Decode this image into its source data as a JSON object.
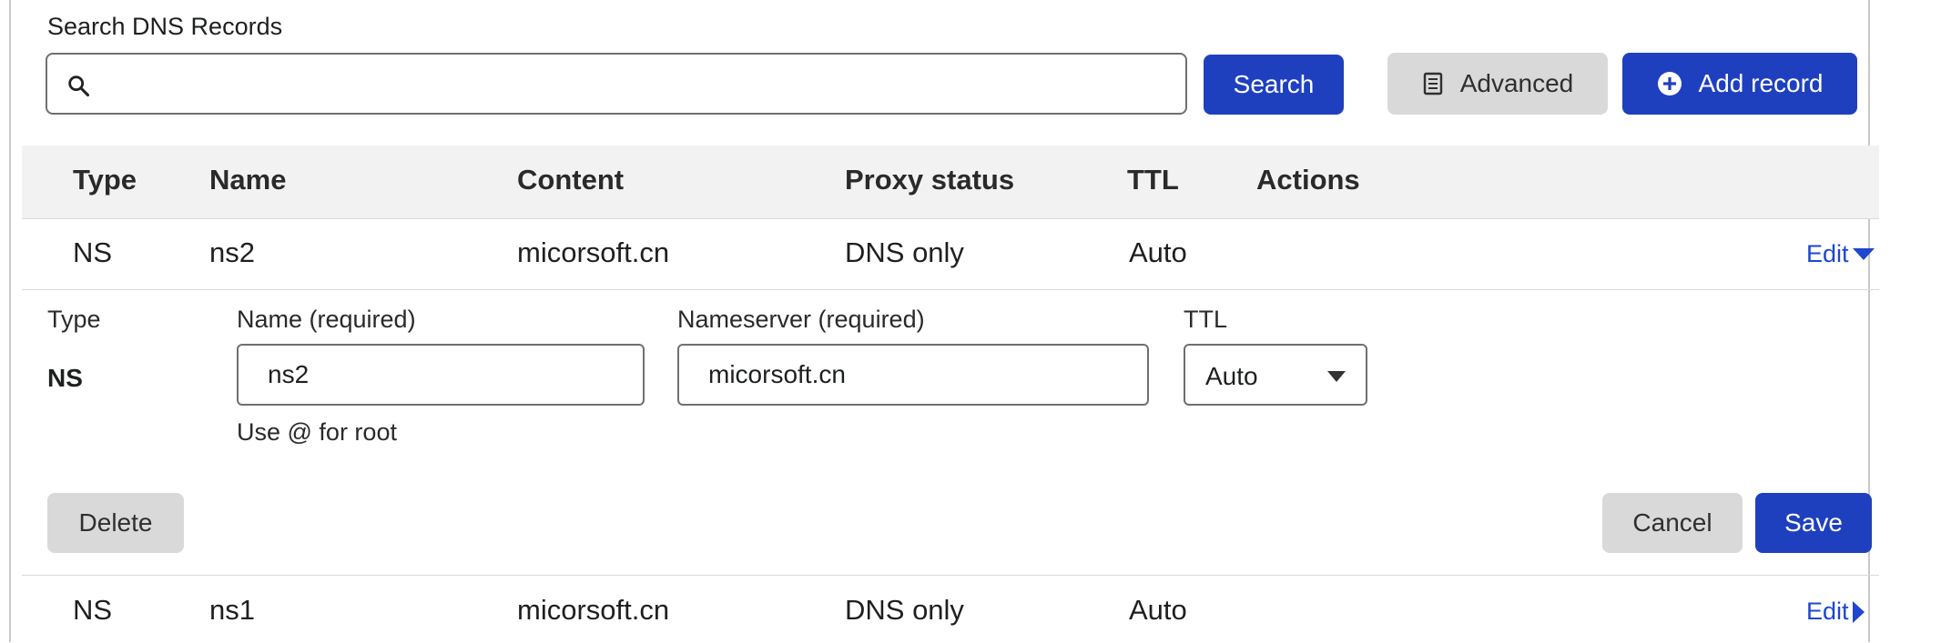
{
  "search": {
    "label": "Search DNS Records",
    "value": "",
    "button": "Search"
  },
  "toolbar": {
    "advanced": "Advanced",
    "add_record": "Add record"
  },
  "table": {
    "headers": [
      "Type",
      "Name",
      "Content",
      "Proxy status",
      "TTL",
      "Actions"
    ],
    "rows": [
      {
        "type": "NS",
        "name": "ns2",
        "content": "micorsoft.cn",
        "proxy": "DNS only",
        "ttl": "Auto",
        "action": "Edit",
        "expanded": true
      },
      {
        "type": "NS",
        "name": "ns1",
        "content": "micorsoft.cn",
        "proxy": "DNS only",
        "ttl": "Auto",
        "action": "Edit",
        "expanded": false
      }
    ]
  },
  "editor": {
    "type_label": "Type",
    "type_value": "NS",
    "name_label": "Name (required)",
    "name_value": "ns2",
    "name_hint": "Use @ for root",
    "nameserver_label": "Nameserver (required)",
    "nameserver_value": "micorsoft.cn",
    "ttl_label": "TTL",
    "ttl_value": "Auto",
    "delete": "Delete",
    "cancel": "Cancel",
    "save": "Save"
  },
  "icons": {
    "search": "search-icon",
    "advanced": "document-icon",
    "add": "plus-circle-icon",
    "expanded": "caret-down-icon",
    "collapsed": "caret-right-icon"
  },
  "colors": {
    "primary": "#1e40bf",
    "link": "#1e46cf",
    "grey_button": "#d9d9d9",
    "header_bg": "#f2f2f2"
  }
}
